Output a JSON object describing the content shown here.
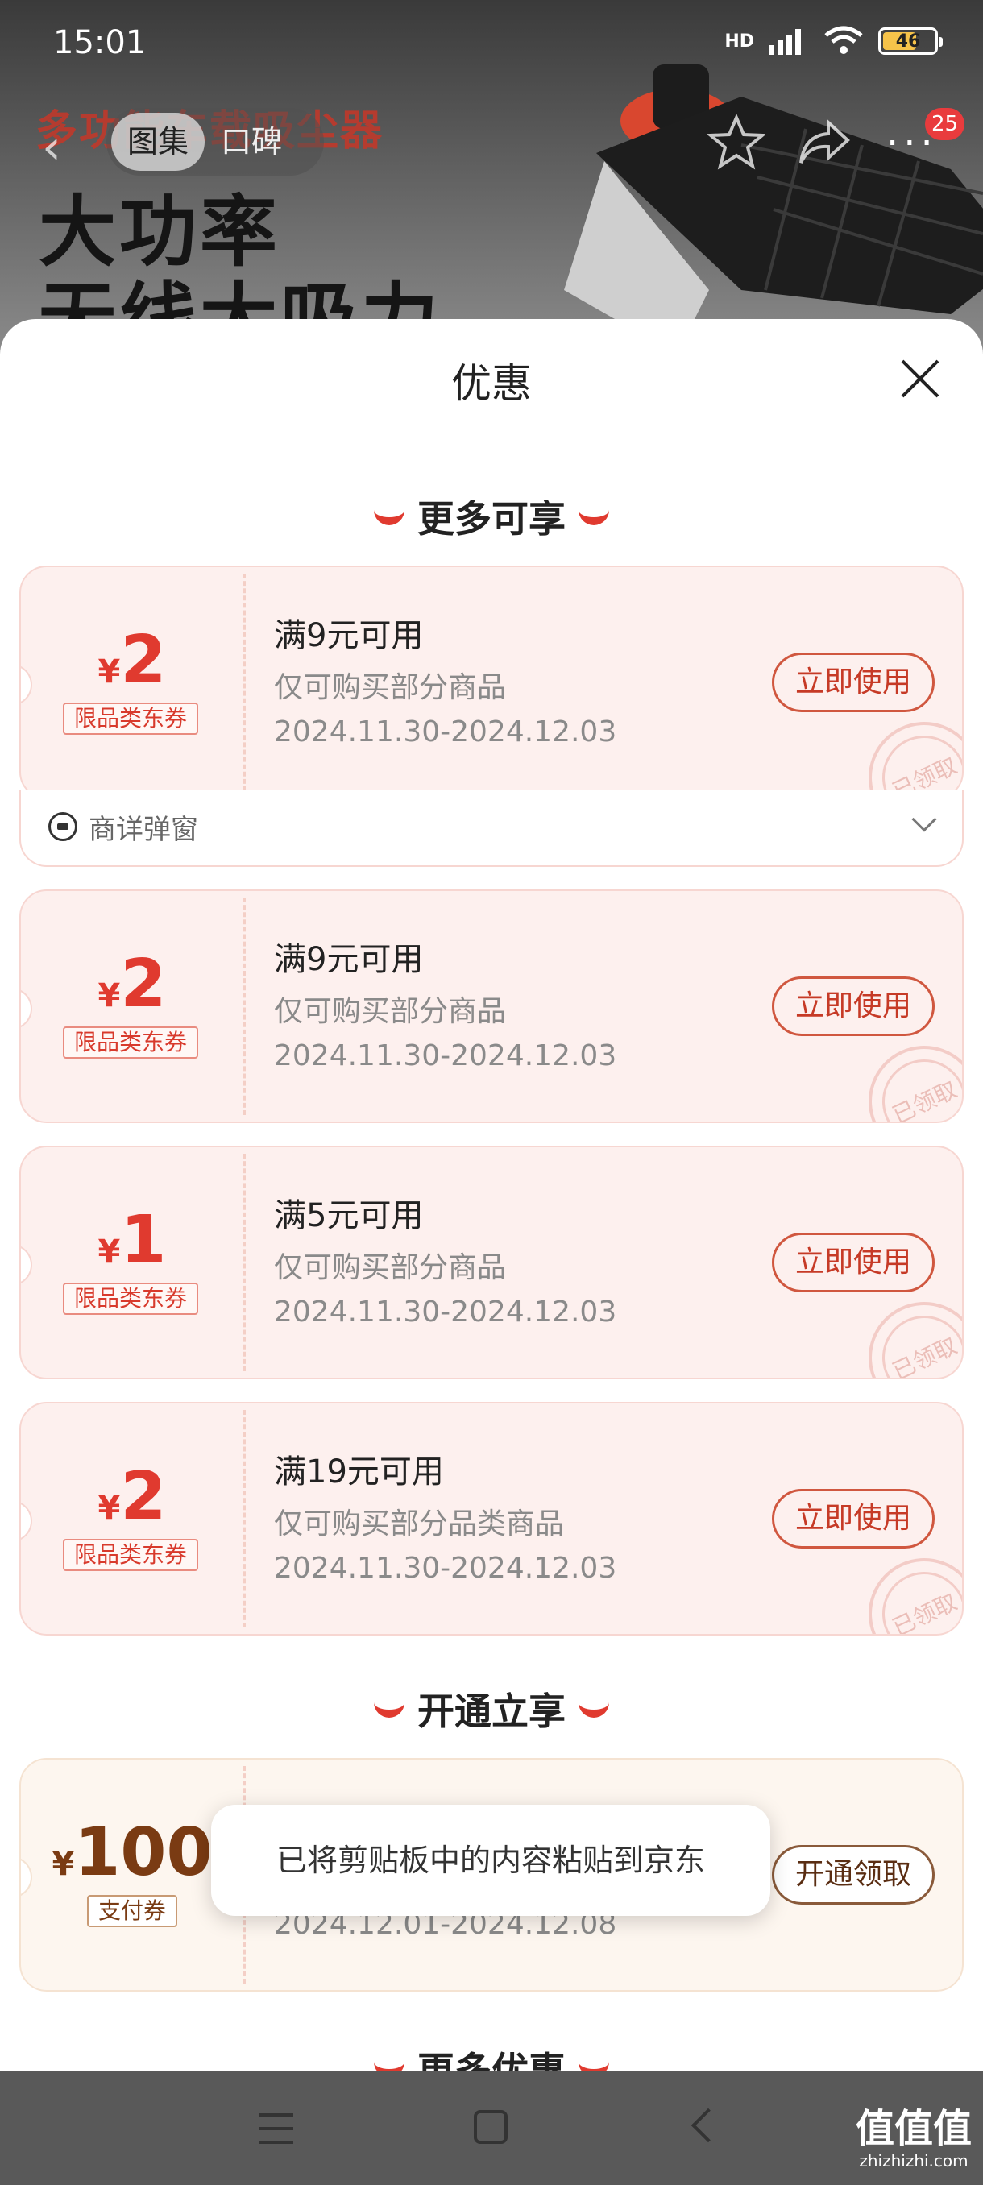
{
  "status": {
    "time": "15:01",
    "battery": "46",
    "network": "HD"
  },
  "product": {
    "title": "多功能车载吸尘器",
    "line1": "大功率",
    "line2": "无线大吸力"
  },
  "header": {
    "tabs": [
      {
        "label": "图集"
      },
      {
        "label": "口碑"
      }
    ],
    "badge": "25"
  },
  "sheet": {
    "title": "优惠",
    "section1": "更多可享",
    "section2": "开通立享",
    "section3": "更多优惠",
    "coupons": [
      {
        "yen": "¥",
        "amount": "2",
        "type": "限品类东券",
        "condition": "满9元可用",
        "scope": "仅可购买部分商品",
        "date": "2024.11.30-2024.12.03",
        "button": "立即使用",
        "stamp": "已领取"
      },
      {
        "yen": "¥",
        "amount": "2",
        "type": "限品类东券",
        "condition": "满9元可用",
        "scope": "仅可购买部分商品",
        "date": "2024.11.30-2024.12.03",
        "button": "立即使用",
        "stamp": "已领取"
      },
      {
        "yen": "¥",
        "amount": "1",
        "type": "限品类东券",
        "condition": "满5元可用",
        "scope": "仅可购买部分商品",
        "date": "2024.11.30-2024.12.03",
        "button": "立即使用",
        "stamp": "已领取"
      },
      {
        "yen": "¥",
        "amount": "2",
        "type": "限品类东券",
        "condition": "满19元可用",
        "scope": "仅可购买部分品类商品",
        "date": "2024.11.30-2024.12.03",
        "button": "立即使用",
        "stamp": "已领取"
      }
    ],
    "source_row": {
      "label": "商详弹窗"
    },
    "pay_coupon": {
      "yen": "¥",
      "amount": "100",
      "type": "支付券",
      "date": "2024.12.01-2024.12.08",
      "button": "开通领取"
    }
  },
  "toast": "已将剪贴板中的内容粘贴到京东",
  "watermark": {
    "logo": "值值值",
    "site": "zhizhizhi.com"
  },
  "colors": {
    "accent": "#e03a2f",
    "coupon_bg": "#fdf0ee",
    "pay_text": "#7a3b13"
  }
}
